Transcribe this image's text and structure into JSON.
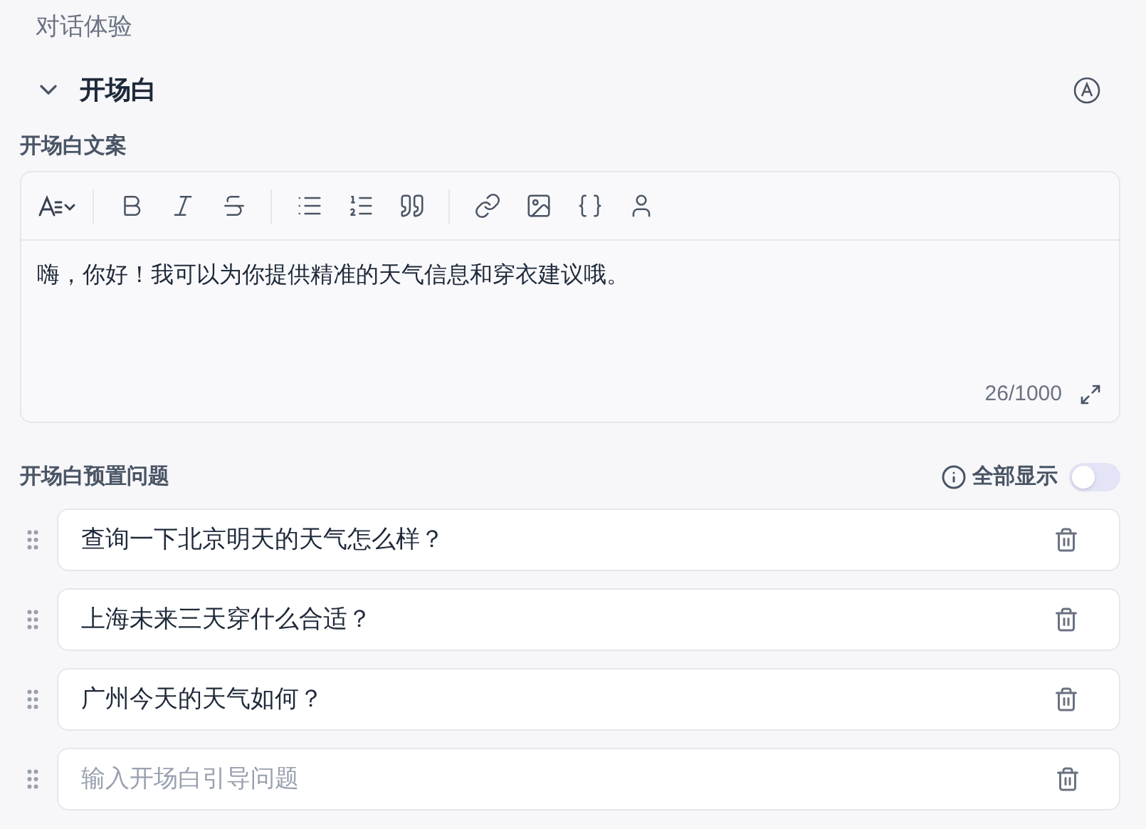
{
  "section_title": "对话体验",
  "opening": {
    "title": "开场白",
    "expanded": true
  },
  "editor": {
    "label": "开场白文案",
    "toolbar": [
      {
        "kind": "font-size"
      },
      {
        "kind": "divider"
      },
      {
        "kind": "bold"
      },
      {
        "kind": "italic"
      },
      {
        "kind": "strike"
      },
      {
        "kind": "divider"
      },
      {
        "kind": "bullet-list"
      },
      {
        "kind": "ordered-list"
      },
      {
        "kind": "quote"
      },
      {
        "kind": "divider"
      },
      {
        "kind": "link"
      },
      {
        "kind": "image"
      },
      {
        "kind": "code"
      },
      {
        "kind": "user"
      }
    ],
    "content": "嗨，你好！我可以为你提供精准的天气信息和穿衣建议哦。",
    "counter": "26/1000"
  },
  "questions": {
    "label": "开场白预置问题",
    "show_all": {
      "label": "全部显示",
      "on": false
    },
    "items": [
      {
        "text": "查询一下北京明天的天气怎么样？"
      },
      {
        "text": "上海未来三天穿什么合适？"
      },
      {
        "text": "广州今天的天气如何？"
      }
    ],
    "new_placeholder": "输入开场白引导问题"
  }
}
